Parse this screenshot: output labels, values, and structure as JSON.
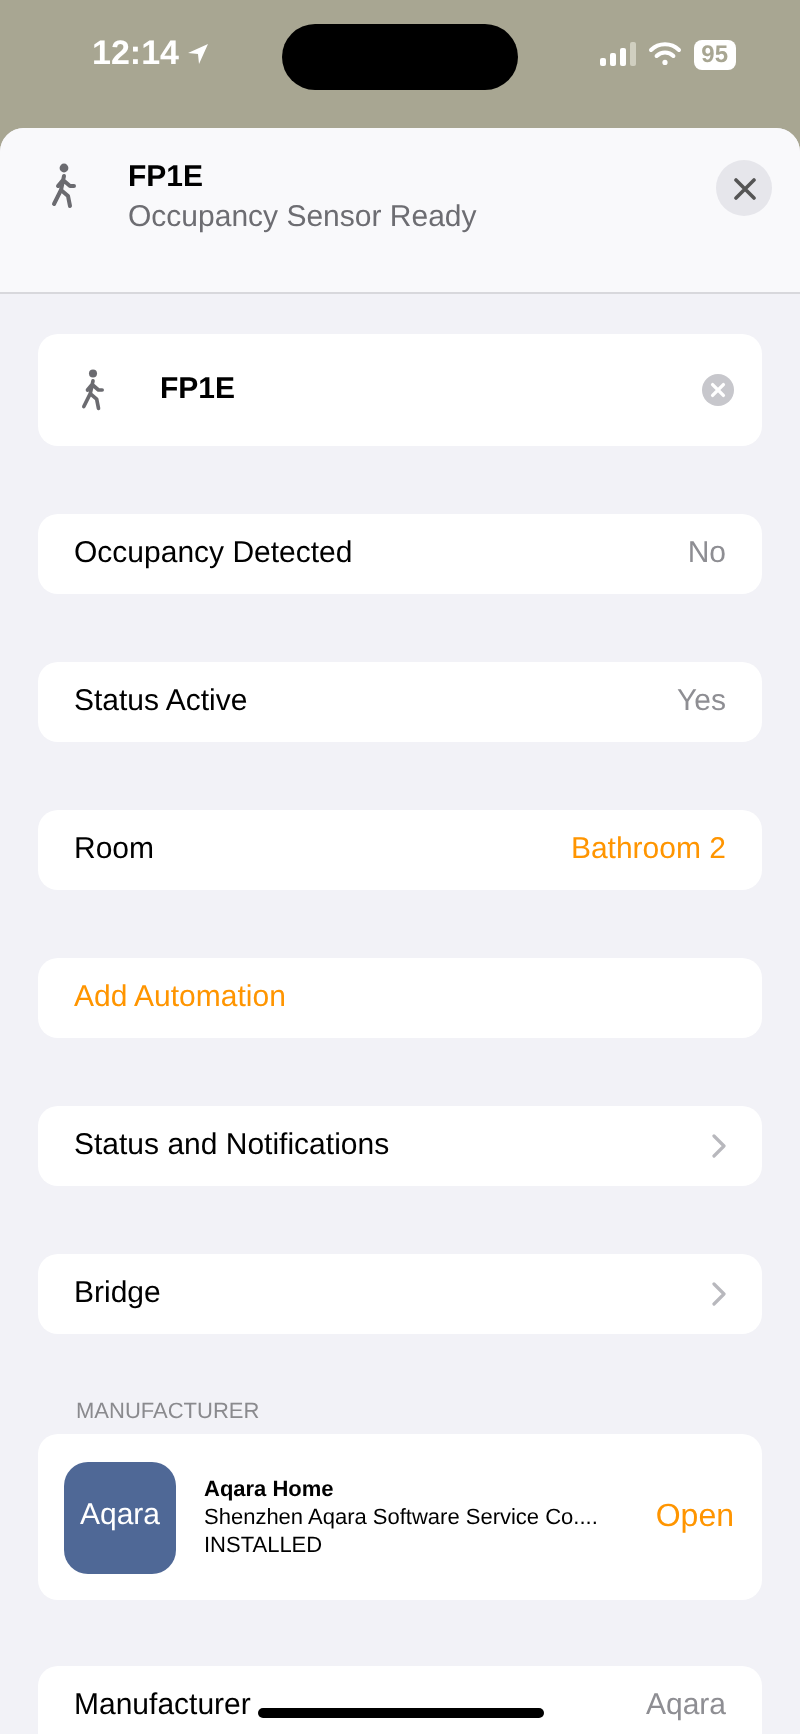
{
  "status_bar": {
    "time": "12:14",
    "battery": "95"
  },
  "header": {
    "title": "FP1E",
    "subtitle": "Occupancy Sensor Ready"
  },
  "name_field": {
    "value": "FP1E"
  },
  "rows": [
    {
      "kind": "value",
      "label": "Occupancy Detected",
      "value": "No"
    },
    {
      "kind": "value",
      "label": "Status Active",
      "value": "Yes"
    },
    {
      "kind": "picker",
      "label": "Room",
      "value": "Bathroom 2"
    },
    {
      "kind": "action",
      "label": "Add Automation"
    },
    {
      "kind": "disclosure",
      "label": "Status and Notifications"
    },
    {
      "kind": "disclosure",
      "label": "Bridge"
    }
  ],
  "manufacturer_section": {
    "heading": "MANUFACTURER",
    "app_name": "Aqara Home",
    "developer": "Shenzhen Aqara Software Service Co....",
    "status": "INSTALLED",
    "icon_text": "Aqara",
    "action": "Open"
  },
  "info_rows": [
    {
      "label": "Manufacturer",
      "value": "Aqara"
    }
  ]
}
